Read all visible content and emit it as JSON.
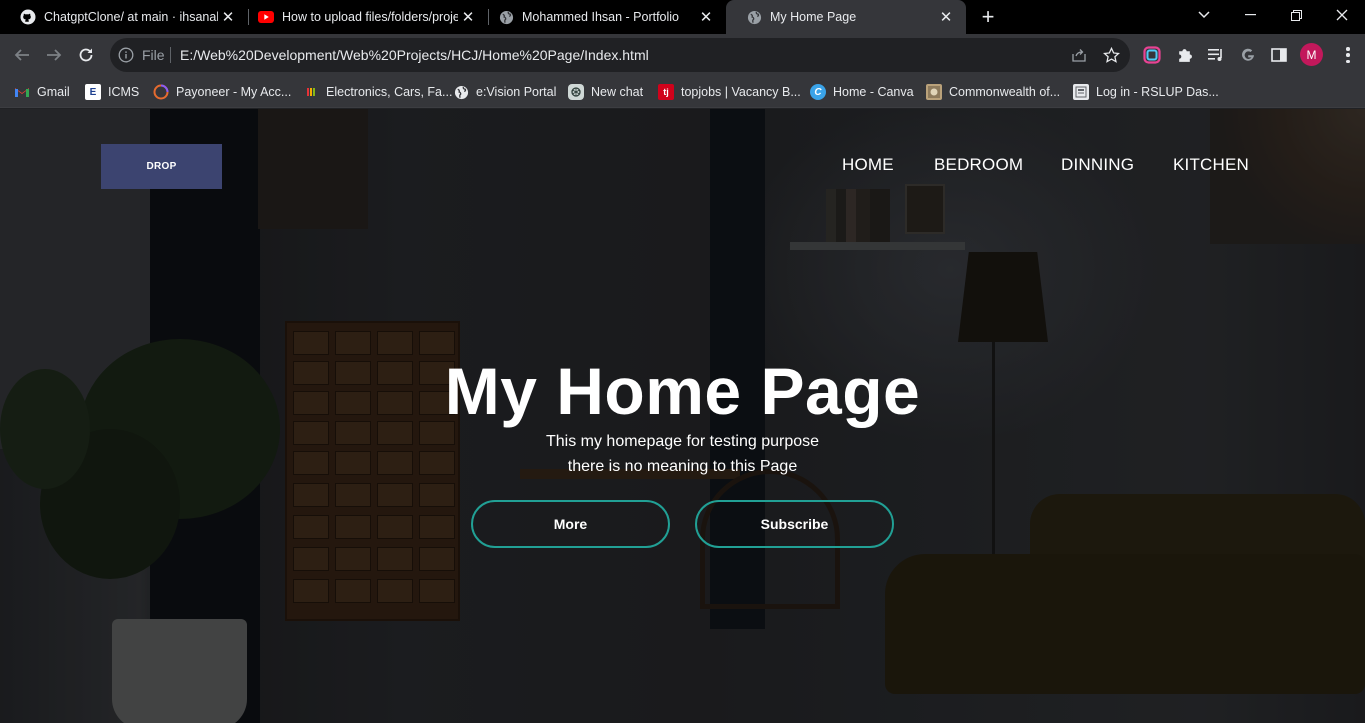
{
  "browser": {
    "tabs": [
      {
        "title": "ChatgptClone/ at main · ihsanakram",
        "icon": "github-icon"
      },
      {
        "title": "How to upload files/folders/projects",
        "icon": "youtube-icon"
      },
      {
        "title": "Mohammed Ihsan - Portfolio",
        "icon": "globe-icon"
      },
      {
        "title": "My Home Page",
        "icon": "globe-icon",
        "active": true
      }
    ],
    "address": {
      "scheme_label": "File",
      "url": "E:/Web%20Development/Web%20Projects/HCJ/Home%20Page/Index.html"
    },
    "profile_initial": "M",
    "bookmarks": [
      {
        "label": "Gmail",
        "icon": "gmail-icon"
      },
      {
        "label": "ICMS",
        "icon": "icms-icon"
      },
      {
        "label": "Payoneer - My Acc...",
        "icon": "payoneer-icon"
      },
      {
        "label": "Electronics, Cars, Fa...",
        "icon": "ebay-icon"
      },
      {
        "label": "e:Vision Portal",
        "icon": "globe-icon"
      },
      {
        "label": "New chat",
        "icon": "openai-icon"
      },
      {
        "label": "topjobs | Vacancy B...",
        "icon": "topjobs-icon"
      },
      {
        "label": "Home - Canva",
        "icon": "canva-icon"
      },
      {
        "label": "Commonwealth of...",
        "icon": "commonwealth-icon"
      },
      {
        "label": "Log in - RSLUP Das...",
        "icon": "rslup-icon"
      }
    ]
  },
  "site": {
    "logo_text": "DROP",
    "nav": [
      "HOME",
      "BEDROOM",
      "DINNING",
      "KITCHEN"
    ],
    "hero": {
      "title": "My Home Page",
      "subtitle_line1": "This my homepage for testing purpose",
      "subtitle_line2": "there is no meaning to this Page"
    },
    "buttons": {
      "more": "More",
      "subscribe": "Subscribe"
    },
    "colors": {
      "logo_bg": "#3c4470",
      "button_border": "#21a095"
    }
  }
}
